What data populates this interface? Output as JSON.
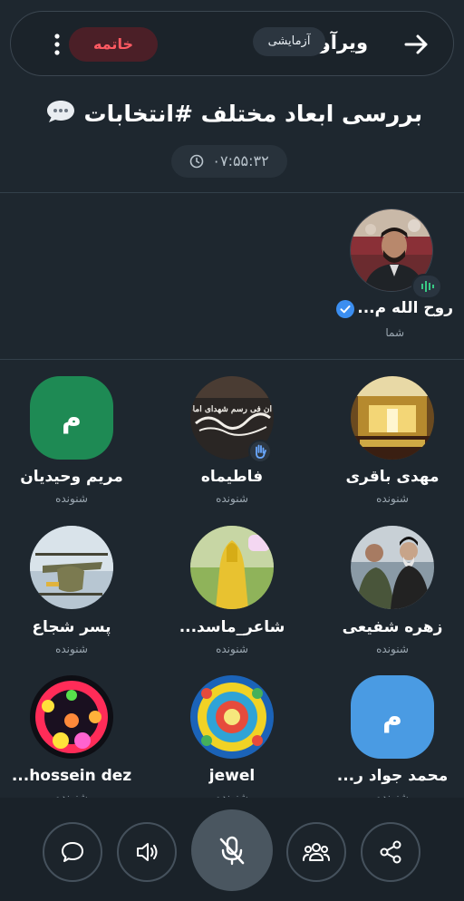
{
  "header": {
    "brand": "ویرآوا",
    "beta_badge": "آزمایشی",
    "end_button": "خاتمه"
  },
  "room": {
    "title": "بررسی ابعاد مختلف #انتخابات",
    "timer": "۰۷:۵۵:۳۲"
  },
  "speaker": {
    "name": "روح الله م...",
    "role": "شما"
  },
  "listeners": [
    {
      "name": "مهدی باقری",
      "role": "شنونده"
    },
    {
      "name": "فاطیماه",
      "role": "شنونده"
    },
    {
      "name": "مریم وحیدیان",
      "role": "شنونده",
      "avatar_letter": "م"
    },
    {
      "name": "زهره شفیعی",
      "role": "شنونده"
    },
    {
      "name": "شاعر_ماسد...",
      "role": "شنونده"
    },
    {
      "name": "پسر شجاع",
      "role": "شنونده"
    },
    {
      "name": "محمد جواد ر...",
      "role": "شنونده",
      "avatar_letter": "م"
    },
    {
      "name": "jewel",
      "role": "شنونده"
    },
    {
      "name": "hossein dez...",
      "role": "شنونده"
    }
  ],
  "avatar_calligraphy": "ان فی رسم شهدای امام کربلا",
  "colors": {
    "background": "#1e272f",
    "end_red": "#ff5a62",
    "green_avatar": "#1e8a54",
    "blue_avatar": "#4a9be3"
  },
  "bottom_bar": {
    "buttons": [
      "chat-icon",
      "speaker-volume-icon",
      "mic-off-icon",
      "people-icon",
      "share-icon"
    ]
  }
}
